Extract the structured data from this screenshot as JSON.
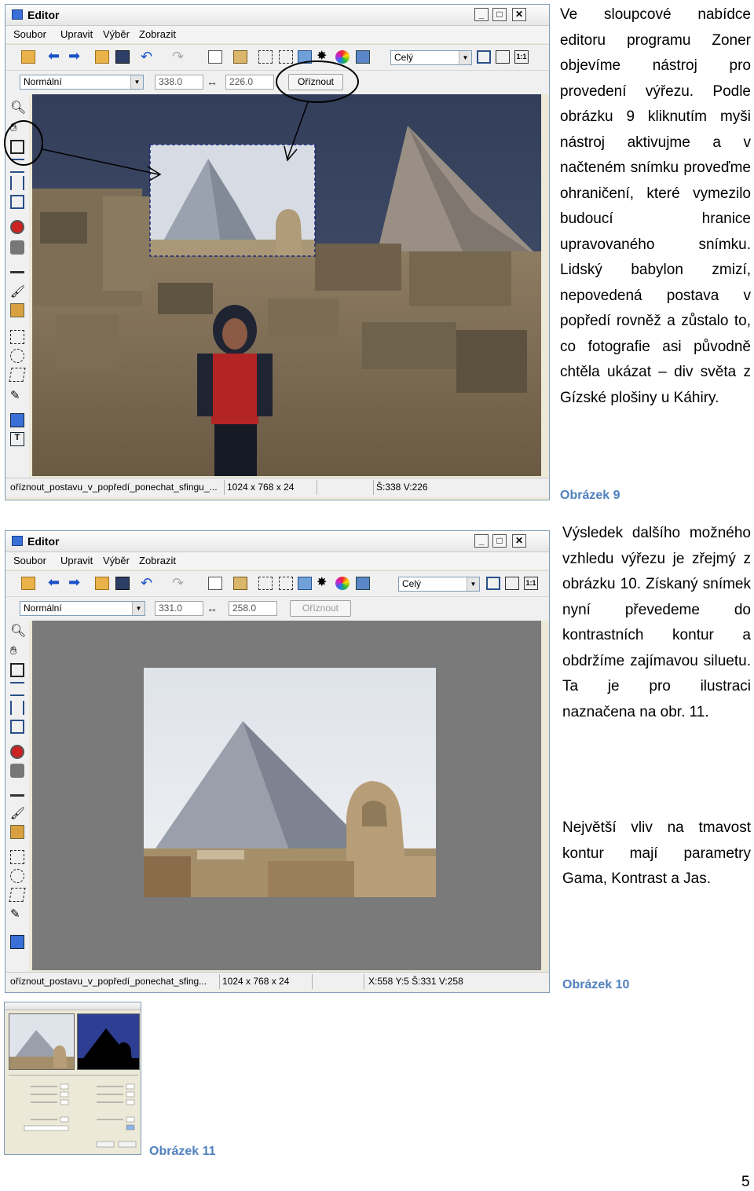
{
  "paragraphs": {
    "p1": "Ve sloupcové nabídce editoru programu Zoner objevíme nástroj pro provedení výřezu. Podle obrázku 9 kliknutím myši nástroj aktivujme a v načteném snímku proveďme ohraničení, které vymezilo budoucí hranice upravovaného snímku. Lidský babylon zmizí, nepovedená postava v popředí rovněž a zůstalo to, co fotografie asi původně chtěla ukázat – div světa z Gízské plošiny u Káhiry.",
    "p2": "Výsledek dalšího možného vzhledu výřezu je zřejmý z obrázku 10. Získaný snímek nyní převedeme do kontrastních kontur a obdržíme zajímavou siluetu. Ta je pro ilustraci naznačena na obr. 11.",
    "p3": "Největší vliv na tmavost kontur mají parametry Gama, Kontrast a Jas."
  },
  "captions": {
    "fig9": "Obrázek 9",
    "fig10": "Obrázek 10",
    "fig11": "Obrázek 11"
  },
  "page_number": "5",
  "editor_common": {
    "title": "Editor",
    "menu": [
      "Soubor",
      "Upravit",
      "Výběr",
      "Zobrazit"
    ],
    "mode": "Normální",
    "zoom": "Celý",
    "crop_label": "Oříznout",
    "zoom_fit_label": "1:1",
    "win_minimize": "_",
    "win_maximize": "□",
    "win_close": "✕"
  },
  "editor9": {
    "width_value": "338.0",
    "height_value": "226.0",
    "status_file": "oříznout_postavu_v_popředí_ponechat_sfingu_...",
    "status_size": "1024 x 768 x 24",
    "status_info": "Š:338  V:226"
  },
  "editor10": {
    "width_value": "331.0",
    "height_value": "258.0",
    "status_file": "oříznout_postavu_v_popředí_ponechat_sfing...",
    "status_size": "1024 x 768 x 24",
    "status_info": "X:558  Y:5  Š:331  V:258"
  },
  "colors": {
    "caption": "#4f81bd",
    "sky": "#3b4a66",
    "sand": "#8e7a5c",
    "annotation": "#000000"
  }
}
